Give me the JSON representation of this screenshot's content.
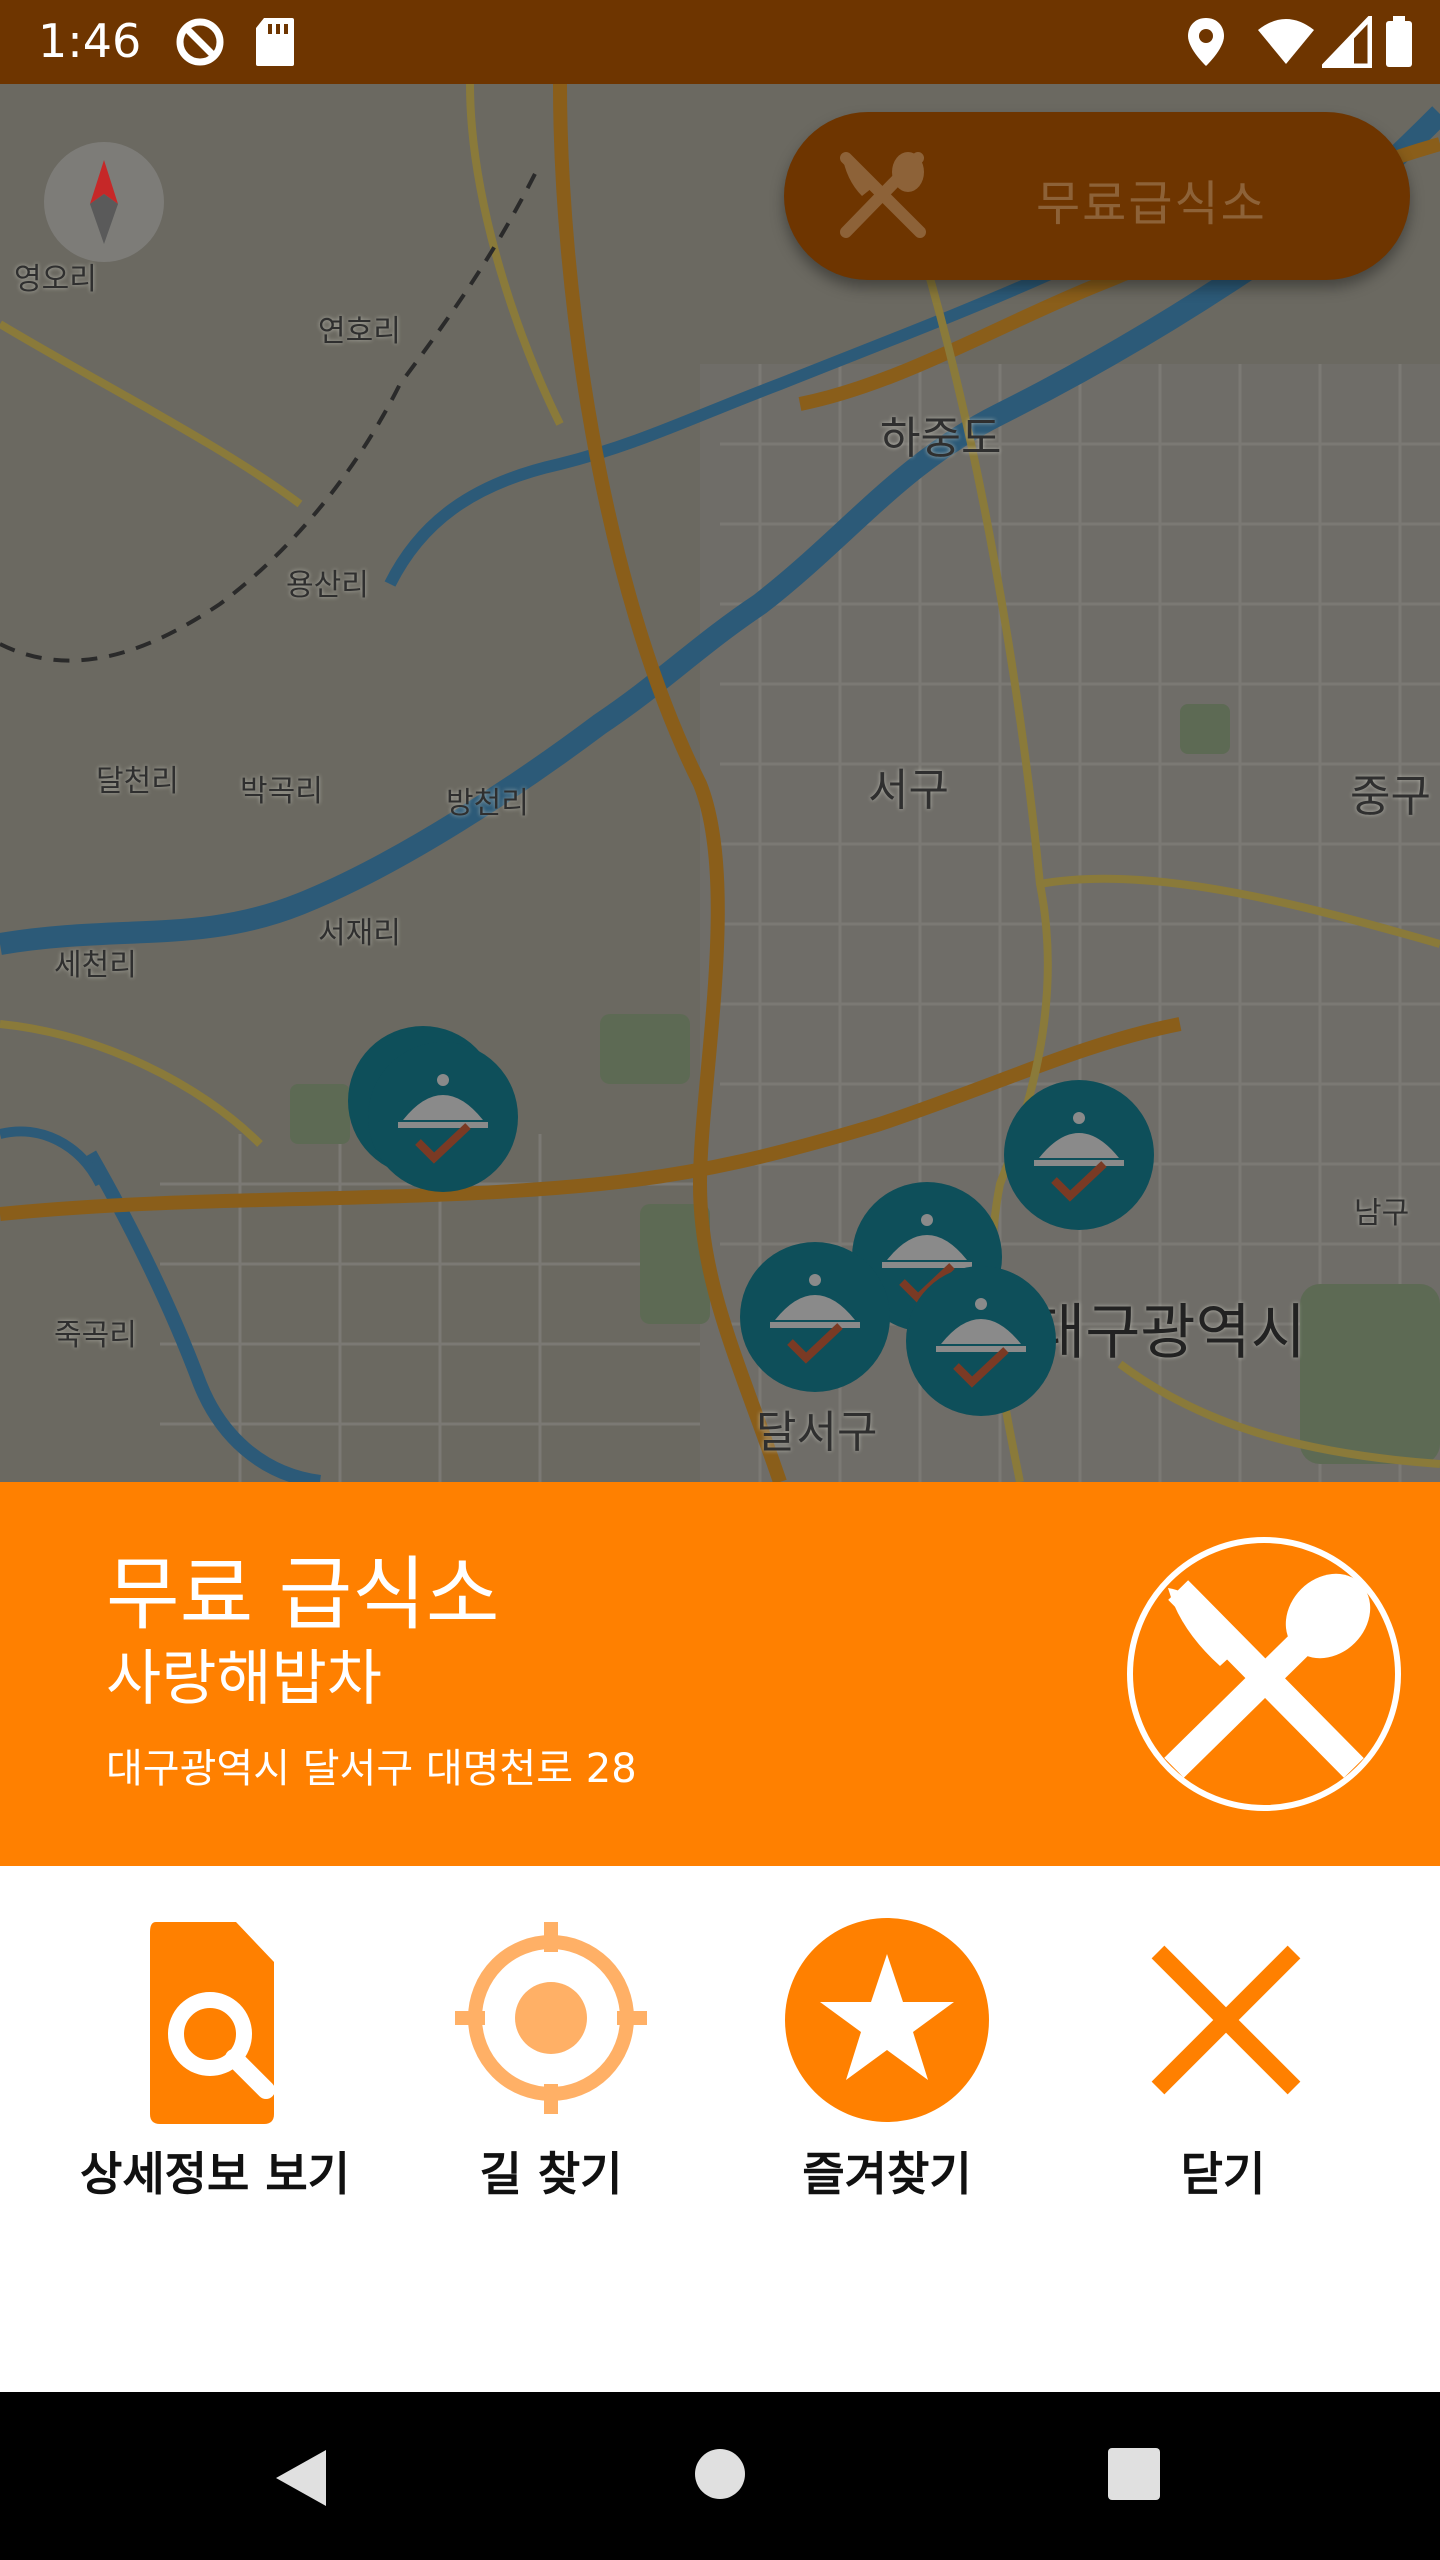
{
  "status_bar": {
    "time": "1:46",
    "icons": [
      "no-disturb-icon",
      "sd-card-icon",
      "location-icon",
      "wifi-icon",
      "signal-icon",
      "battery-icon"
    ]
  },
  "map": {
    "labels": {
      "yeongori": "영오리",
      "yeonhori": "연호리",
      "hajungdo": "하중도",
      "yongsanri": "용산리",
      "seogu": "서구",
      "junggu": "중구",
      "dalcheonri": "달천리",
      "bakgokri": "박곡리",
      "bangcheonri": "방천리",
      "seojaeri": "서재리",
      "secheonri": "세천리",
      "namgu": "남구",
      "jukgokri": "죽곡리",
      "daegu": "대구광역시",
      "dalseogu": "달서구"
    },
    "compass_icon": "compass-icon",
    "filter_chip": {
      "icon": "utensils-icon",
      "label": "무료급식소"
    },
    "marker_icon": "food-cloche-check-icon"
  },
  "info_panel": {
    "category": "무료 급식소",
    "name": "사랑해밥차",
    "address": "대구광역시 달서구 대명천로 28",
    "logo_icon": "utensils-circle-icon",
    "color": "#FF8000"
  },
  "actions": {
    "details": {
      "label": "상세정보 보기",
      "icon": "document-search-icon"
    },
    "directions": {
      "label": "길 찾기",
      "icon": "crosshair-target-icon"
    },
    "favorite": {
      "label": "즐겨찾기",
      "icon": "star-circle-icon"
    },
    "close": {
      "label": "닫기",
      "icon": "close-icon"
    }
  },
  "nav_bar": {
    "back": "back-triangle-icon",
    "home": "home-circle-icon",
    "recents": "recents-square-icon"
  },
  "colors": {
    "accent": "#FF8000",
    "accent_light": "#FFB066",
    "status_bar": "#6E3500",
    "marker": "#0E4F5A"
  }
}
